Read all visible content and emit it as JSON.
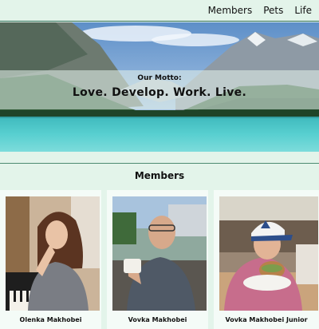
{
  "nav": {
    "items": [
      {
        "label": "Members"
      },
      {
        "label": "Pets"
      },
      {
        "label": "Life"
      }
    ]
  },
  "hero": {
    "motto_label": "Our Motto:",
    "motto_text": "Love. Develop. Work. Live."
  },
  "members": {
    "title": "Members",
    "cards": [
      {
        "name": "Olenka Makhobei"
      },
      {
        "name": "Vovka Makhobei"
      },
      {
        "name": "Vovka Makhobei Junior"
      }
    ]
  }
}
